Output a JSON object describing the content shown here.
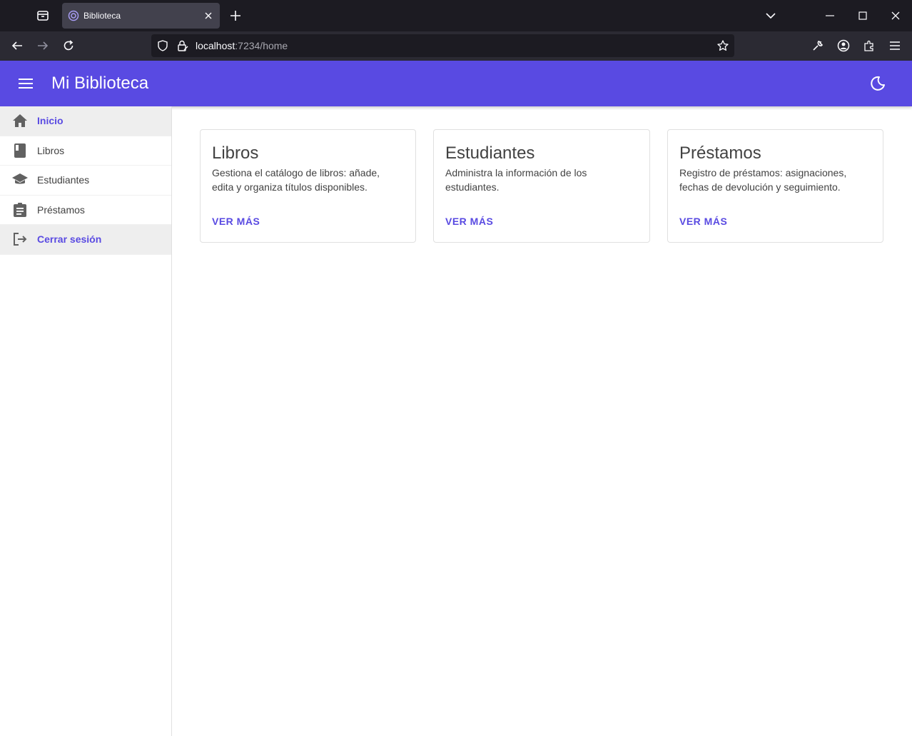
{
  "browser": {
    "tab_title": "Biblioteca",
    "url_host": "localhost",
    "url_rest": ":7234/home"
  },
  "app": {
    "title": "Mi Biblioteca"
  },
  "sidebar": {
    "items": [
      {
        "label": "Inicio",
        "icon": "home-icon"
      },
      {
        "label": "Libros",
        "icon": "book-icon"
      },
      {
        "label": "Estudiantes",
        "icon": "school-icon"
      },
      {
        "label": "Préstamos",
        "icon": "clipboard-icon"
      },
      {
        "label": "Cerrar sesión",
        "icon": "logout-icon"
      }
    ]
  },
  "cards": [
    {
      "title": "Libros",
      "description": "Gestiona el catálogo de libros: añade, edita y organiza títulos disponibles.",
      "action": "VER MÁS"
    },
    {
      "title": "Estudiantes",
      "description": "Administra la información de los estudiantes.",
      "action": "VER MÁS"
    },
    {
      "title": "Préstamos",
      "description": "Registro de préstamos: asignaciones, fechas de devolución y seguimiento.",
      "action": "VER MÁS"
    }
  ],
  "colors": {
    "primary": "#594ae2",
    "tabbar": "#1c1b22",
    "navbar": "#2b2a33"
  }
}
